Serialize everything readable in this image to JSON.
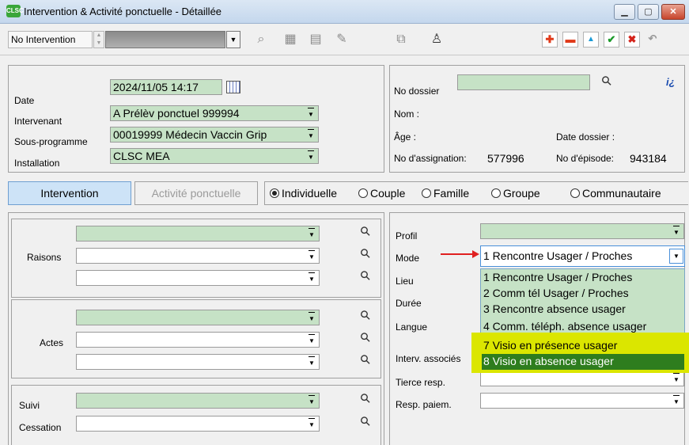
{
  "window": {
    "title": "Intervention & Activité ponctuelle - Détaillée",
    "app_icon_text": "CLSC",
    "buttons": [
      "minimize-icon",
      "maximize-icon",
      "close-icon"
    ]
  },
  "toolbar": {
    "intervention_label": "No Intervention",
    "intervention_value": "",
    "action_icons": [
      "plus-icon",
      "minus-icon",
      "up-icon",
      "check-icon",
      "x-icon",
      "undo-icon"
    ]
  },
  "header_left": {
    "date_label": "Date",
    "date_value": "2024/11/05 14:17",
    "intervenant_label": "Intervenant",
    "intervenant_value": "A Prélèv ponctuel 999994",
    "sousprog_label": "Sous-programme",
    "sousprog_value": "00019999 Médecin Vaccin Grip",
    "installation_label": "Installation",
    "installation_value": "CLSC MEA"
  },
  "header_right": {
    "dossier_label": "No dossier",
    "dossier_value": "",
    "nom_label": "Nom :",
    "age_label": "Âge :",
    "date_dossier_label": "Date dossier :",
    "assign_label": "No d'assignation:",
    "assign_value": "577996",
    "episode_label": "No d'épisode:",
    "episode_value": "943184"
  },
  "tabs": {
    "intervention": "Intervention",
    "activite": "Activité ponctuelle",
    "radios": [
      {
        "label": "Individuelle",
        "checked": true
      },
      {
        "label": "Couple",
        "checked": false
      },
      {
        "label": "Famille",
        "checked": false
      },
      {
        "label": "Groupe",
        "checked": false
      },
      {
        "label": "Communautaire",
        "checked": false
      }
    ]
  },
  "left_sections": {
    "raisons_label": "Raisons",
    "actes_label": "Actes",
    "suivi_label": "Suivi",
    "cessation_label": "Cessation"
  },
  "right_fields": {
    "profil_label": "Profil",
    "mode_label": "Mode",
    "mode_value": "1 Rencontre Usager / Proches",
    "lieu_label": "Lieu",
    "duree_label": "Durée",
    "langue_label": "Langue",
    "interv_label": "Interv. associés",
    "tierce_label": "Tierce resp.",
    "resp_label": "Resp. paiem."
  },
  "mode_options": [
    "1 Rencontre Usager / Proches",
    "2 Comm tél  Usager / Proches",
    "3 Rencontre absence usager",
    "4 Comm. téléph. absence usager",
    "7 Visio en présence usager",
    "8 Visio en absence usager"
  ],
  "colors": {
    "field_green": "#c6e2c6",
    "highlight_yellow": "#dbe600",
    "selected_dark_green": "#2e7d1e",
    "arrow_red": "#e02020"
  }
}
